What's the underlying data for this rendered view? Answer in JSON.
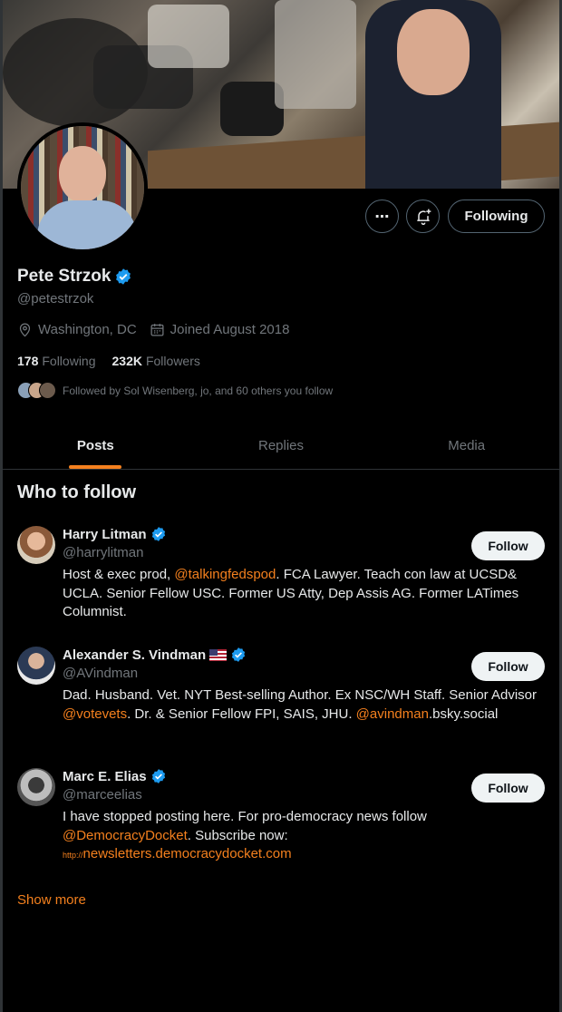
{
  "profile": {
    "name": "Pete Strzok",
    "handle": "@petestrzok",
    "location": "Washington, DC",
    "joined": "Joined August 2018",
    "following_count": "178",
    "following_label": "Following",
    "followers_count": "232K",
    "followers_label": "Followers",
    "followed_by": "Followed by Sol Wisenberg, jo, and 60 others you follow"
  },
  "actions": {
    "more_glyph": "⋯",
    "follow_state": "Following"
  },
  "tabs": [
    {
      "label": "Posts",
      "active": true
    },
    {
      "label": "Replies",
      "active": false
    },
    {
      "label": "Media",
      "active": false
    }
  ],
  "who_to_follow": {
    "title": "Who to follow",
    "button_label": "Follow",
    "show_more": "Show more",
    "users": [
      {
        "name": "Harry Litman",
        "handle": "@harrylitman",
        "bio_parts": [
          "Host & exec prod, ",
          "@talkingfedspod",
          ". FCA Lawyer. Teach con law at UCSD& UCLA. Senior Fellow USC. Former US Atty, Dep Assis AG. Former LATimes Columnist."
        ]
      },
      {
        "name": "Alexander S. Vindman",
        "handle": "@AVindman",
        "bio_parts": [
          "Dad. Husband. Vet. NYT Best-selling Author. Ex NSC/WH Staff. Senior Advisor ",
          "@votevets",
          ". Dr. & Senior Fellow FPI, SAIS, JHU. ",
          "@avindman",
          ".bsky.social"
        ]
      },
      {
        "name": "Marc E. Elias",
        "handle": "@marceelias",
        "bio_parts": [
          "I have stopped posting here. For pro-democracy news follow ",
          "@DemocracyDocket",
          ". Subscribe now: ",
          "http://",
          "newsletters.democracydocket.com"
        ]
      }
    ]
  },
  "colors": {
    "accent": "#f4801e",
    "verified": "#1d9bf0",
    "muted": "#71767b",
    "text": "#e7e9ea"
  },
  "icons": {
    "verified": "verified-badge-icon",
    "location": "location-pin-icon",
    "calendar": "calendar-icon",
    "more": "more-icon",
    "notify": "bell-plus-icon"
  }
}
